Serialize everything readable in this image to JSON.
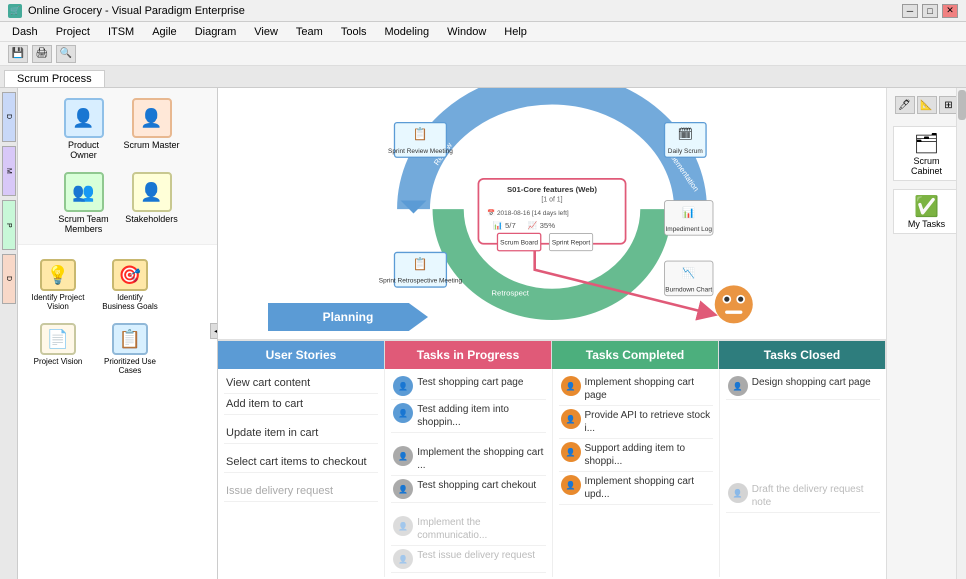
{
  "titlebar": {
    "title": "Online Grocery - Visual Paradigm Enterprise",
    "min_label": "─",
    "max_label": "□",
    "close_label": "✕"
  },
  "menubar": {
    "items": [
      "Dash",
      "Project",
      "ITSM",
      "Agile",
      "Diagram",
      "View",
      "Team",
      "Tools",
      "Modeling",
      "Window",
      "Help"
    ]
  },
  "tab": {
    "label": "Scrum Process"
  },
  "left_panel": {
    "people": [
      {
        "label": "Product Owner",
        "emoji": "👤",
        "color": "#b8d8f8"
      },
      {
        "label": "Scrum Master",
        "emoji": "👤",
        "color": "#f8d8b8"
      },
      {
        "label": "Scrum Team Members",
        "emoji": "👥",
        "color": "#d8f8d8"
      },
      {
        "label": "Stakeholders",
        "emoji": "👤",
        "color": "#f8f8b8"
      }
    ],
    "bottom_items": [
      {
        "label": "Identify Project Vision",
        "emoji": "💡",
        "color": "#ffe0a0"
      },
      {
        "label": "Identify Business Goals",
        "emoji": "🎯",
        "color": "#ffe0a0"
      },
      {
        "label": "Project Vision",
        "emoji": "📄",
        "color": "#fff"
      },
      {
        "label": "Prioritized Use Cases",
        "emoji": "📋",
        "color": "#a0e0ff"
      }
    ]
  },
  "diagram": {
    "sprint_label": "S01-Core features (Web)",
    "sprint_sub": "[1 of 1]",
    "sprint_date": "2018-08-16 [14 days left]",
    "sprint_tasks": "5/7",
    "sprint_percent": "35%",
    "nodes": [
      {
        "label": "Sprint Review Meeting",
        "emoji": "📋"
      },
      {
        "label": "Daily Scrum",
        "emoji": "🗓"
      },
      {
        "label": "Impediment Log",
        "emoji": "📊"
      },
      {
        "label": "Sprint Retrospective Meeting",
        "emoji": "📋"
      },
      {
        "label": "Sprint Report",
        "emoji": "📈"
      },
      {
        "label": "Burndown Chart",
        "emoji": "📉"
      }
    ],
    "scrum_board_label": "Scrum Board",
    "planning_label": "Planning"
  },
  "right_sidebar": {
    "items": [
      {
        "label": "Scrum Cabinet",
        "emoji": "🗂"
      },
      {
        "label": "My Tasks",
        "emoji": "✅"
      }
    ]
  },
  "kanban": {
    "columns": [
      {
        "header": "User Stories",
        "color": "col-user-stories",
        "stories": [
          {
            "text": "View cart content",
            "dimmed": false
          },
          {
            "text": "Add item to cart",
            "dimmed": false
          },
          {
            "text": "Update item in cart",
            "dimmed": false
          },
          {
            "text": "Select cart items to checkout",
            "dimmed": false
          },
          {
            "text": "Issue delivery request",
            "dimmed": true
          }
        ]
      },
      {
        "header": "Tasks in Progress",
        "color": "col-in-progress",
        "tasks": [
          {
            "text": "Test shopping cart page",
            "avatar": "avatar-blue",
            "dimmed": false
          },
          {
            "text": "Test adding item into shoppin...",
            "avatar": "avatar-blue",
            "dimmed": false
          },
          {
            "text": "Implement the shopping cart ...",
            "avatar": "avatar-gray",
            "dimmed": false
          },
          {
            "text": "Test shopping cart chekout",
            "avatar": "avatar-gray",
            "dimmed": false
          },
          {
            "text": "Implement the communicatio...",
            "avatar": "avatar-gray",
            "dimmed": true
          },
          {
            "text": "Test issue delivery request",
            "avatar": "avatar-gray",
            "dimmed": true
          }
        ]
      },
      {
        "header": "Tasks Completed",
        "color": "col-completed",
        "tasks": [
          {
            "text": "Implement shopping cart page",
            "avatar": "avatar-orange",
            "dimmed": false
          },
          {
            "text": "Provide API to retrieve stock i...",
            "avatar": "avatar-orange",
            "dimmed": false
          },
          {
            "text": "Support adding item to shoppi...",
            "avatar": "avatar-orange",
            "dimmed": false
          },
          {
            "text": "Implement shopping cart upd...",
            "avatar": "avatar-orange",
            "dimmed": false
          }
        ]
      },
      {
        "header": "Tasks Closed",
        "color": "col-closed",
        "tasks": [
          {
            "text": "Design shopping cart page",
            "avatar": "avatar-gray",
            "dimmed": false
          },
          {
            "text": "Draft the delivery request note",
            "avatar": "avatar-gray",
            "dimmed": false
          }
        ]
      }
    ]
  },
  "sidebar_icons": [
    "Diagram Navigator",
    "Model Explorer",
    "Property",
    "Diagram (Backlog)"
  ]
}
